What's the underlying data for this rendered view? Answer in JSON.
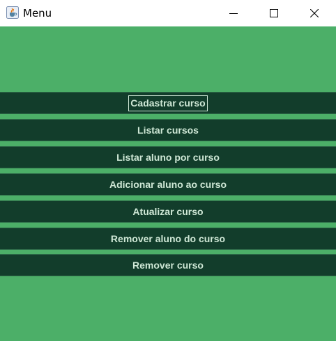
{
  "window": {
    "title": "Menu",
    "icons": {
      "app": "java-cup-icon",
      "minimize": "minimize-icon",
      "maximize": "maximize-icon",
      "close": "close-icon"
    }
  },
  "menu": {
    "buttons": [
      {
        "label": "Cadastrar curso",
        "focused": true
      },
      {
        "label": "Listar cursos"
      },
      {
        "label": "Listar aluno por curso"
      },
      {
        "label": "Adicionar aluno ao curso"
      },
      {
        "label": "Atualizar curso"
      },
      {
        "label": "Remover aluno do curso"
      },
      {
        "label": "Remover curso"
      }
    ]
  },
  "colors": {
    "background": "#4caf68",
    "button": "#123d2b",
    "button_text": "#cfe8d6"
  }
}
